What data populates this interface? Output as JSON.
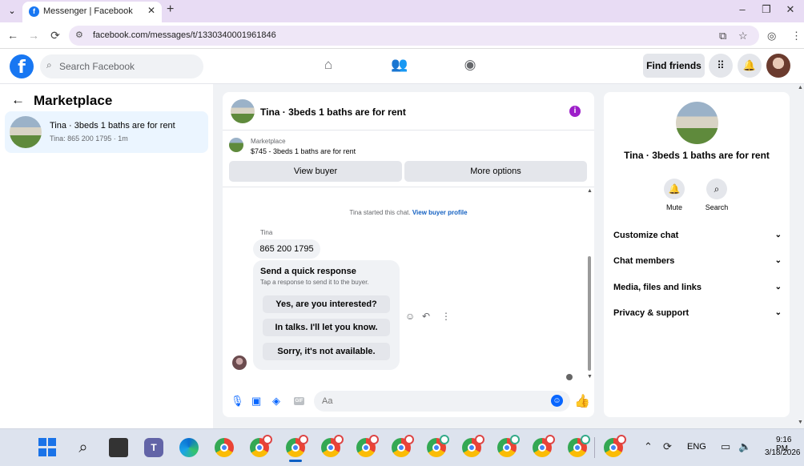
{
  "browser": {
    "tab_title": "Messenger | Facebook",
    "tab_favicon": "f",
    "url": "facebook.com/messages/t/1330340001961846",
    "buttons": {
      "back": "←",
      "forward": "→",
      "reload": "⟳",
      "minimize": "–",
      "restore": "❐",
      "close": "✕",
      "newtab": "+",
      "tabclose": "✕",
      "chevron": "⌄"
    }
  },
  "fb_header": {
    "logo": "f",
    "search_placeholder": "Search Facebook",
    "find_friends": "Find friends",
    "icons": [
      "home-icon",
      "friends-icon",
      "groups-icon",
      "menu-grid-icon",
      "notifications-icon"
    ]
  },
  "left": {
    "title": "Marketplace",
    "conversation": {
      "name": "Tina · 3beds 1 baths are for rent",
      "subtitle": "Tina: 865 200 1795 · 1m"
    }
  },
  "chat": {
    "title": "Tina · 3beds 1 baths are for rent",
    "marketplace_label": "Marketplace",
    "listing": "$745 - 3beds 1 baths are for rent",
    "view_buyer": "View buyer",
    "more_options": "More options",
    "started_text": "Tina started this chat.",
    "view_buyer_profile": "View buyer profile",
    "sender": "Tina",
    "phone_message": "865 200 1795",
    "quick_title": "Send a quick response",
    "quick_sub": "Tap a response to send it to the buyer.",
    "quick_options": [
      "Yes, are you interested?",
      "In talks. I'll let you know.",
      "Sorry, it's not available."
    ],
    "composer_placeholder": "Aa",
    "gif_label": "GIF"
  },
  "right": {
    "title": "Tina · 3beds 1 baths are for rent",
    "mute": "Mute",
    "search": "Search",
    "sections": [
      "Customize chat",
      "Chat members",
      "Media, files and links",
      "Privacy & support"
    ]
  },
  "taskbar": {
    "language": "ENG",
    "time": "9:16 PM",
    "date": "3/18/2026"
  },
  "colors": {
    "fb_blue": "#1877f2",
    "messenger_blue": "#0866ff",
    "selected_row": "#ebf5ff",
    "info_purple": "#9d1fc9"
  }
}
